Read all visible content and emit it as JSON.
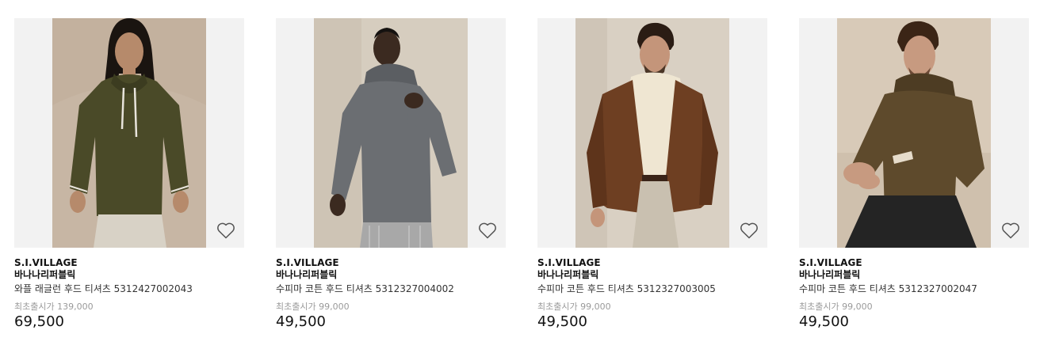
{
  "products": [
    {
      "brand": "S.I.VILLAGE",
      "sub_brand": "바나나리퍼블릭",
      "name": "와플 래글런 후드 티셔츠 5312427002043",
      "original_price": "최초출시가 139,000",
      "price": "69,500",
      "image_colors": {
        "background": "#c7b6a4",
        "garment": "#4a4a28",
        "trim": "#e8e4dc",
        "skin": "#b68a6b",
        "hair": "#1a1410",
        "pants": "#d8d2c6"
      },
      "icon": "heart-outline-icon"
    },
    {
      "brand": "S.I.VILLAGE",
      "sub_brand": "바나나리퍼블릭",
      "name": "수피마 코튼 후드 티셔츠 5312327004002",
      "original_price": "최초출시가 99,000",
      "price": "49,500",
      "image_colors": {
        "background": "#d6cdbf",
        "garment": "#6b6e72",
        "trim": "#5b5e62",
        "skin": "#3b2a20",
        "hair": "#151210",
        "pants": "#a8a8a8"
      },
      "icon": "heart-outline-icon"
    },
    {
      "brand": "S.I.VILLAGE",
      "sub_brand": "바나나리퍼블릭",
      "name": "수피마 코튼 후드 티셔츠 5312327003005",
      "original_price": "최초출시가 99,000",
      "price": "49,500",
      "image_colors": {
        "background": "#d9d0c3",
        "garment": "#6e3f22",
        "trim": "#efe6d2",
        "skin": "#c4957a",
        "hair": "#2a1c14",
        "pants": "#c9c0b0"
      },
      "icon": "heart-outline-icon"
    },
    {
      "brand": "S.I.VILLAGE",
      "sub_brand": "바나나리퍼블릭",
      "name": "수피마 코튼 후드 티셔츠 5312327002047",
      "original_price": "최초출시가 99,000",
      "price": "49,500",
      "image_colors": {
        "background": "#d8cab8",
        "garment": "#5e4a2c",
        "trim": "#e6dccb",
        "skin": "#c79a80",
        "hair": "#3b2516",
        "pants": "#242424"
      },
      "icon": "heart-outline-icon"
    }
  ]
}
